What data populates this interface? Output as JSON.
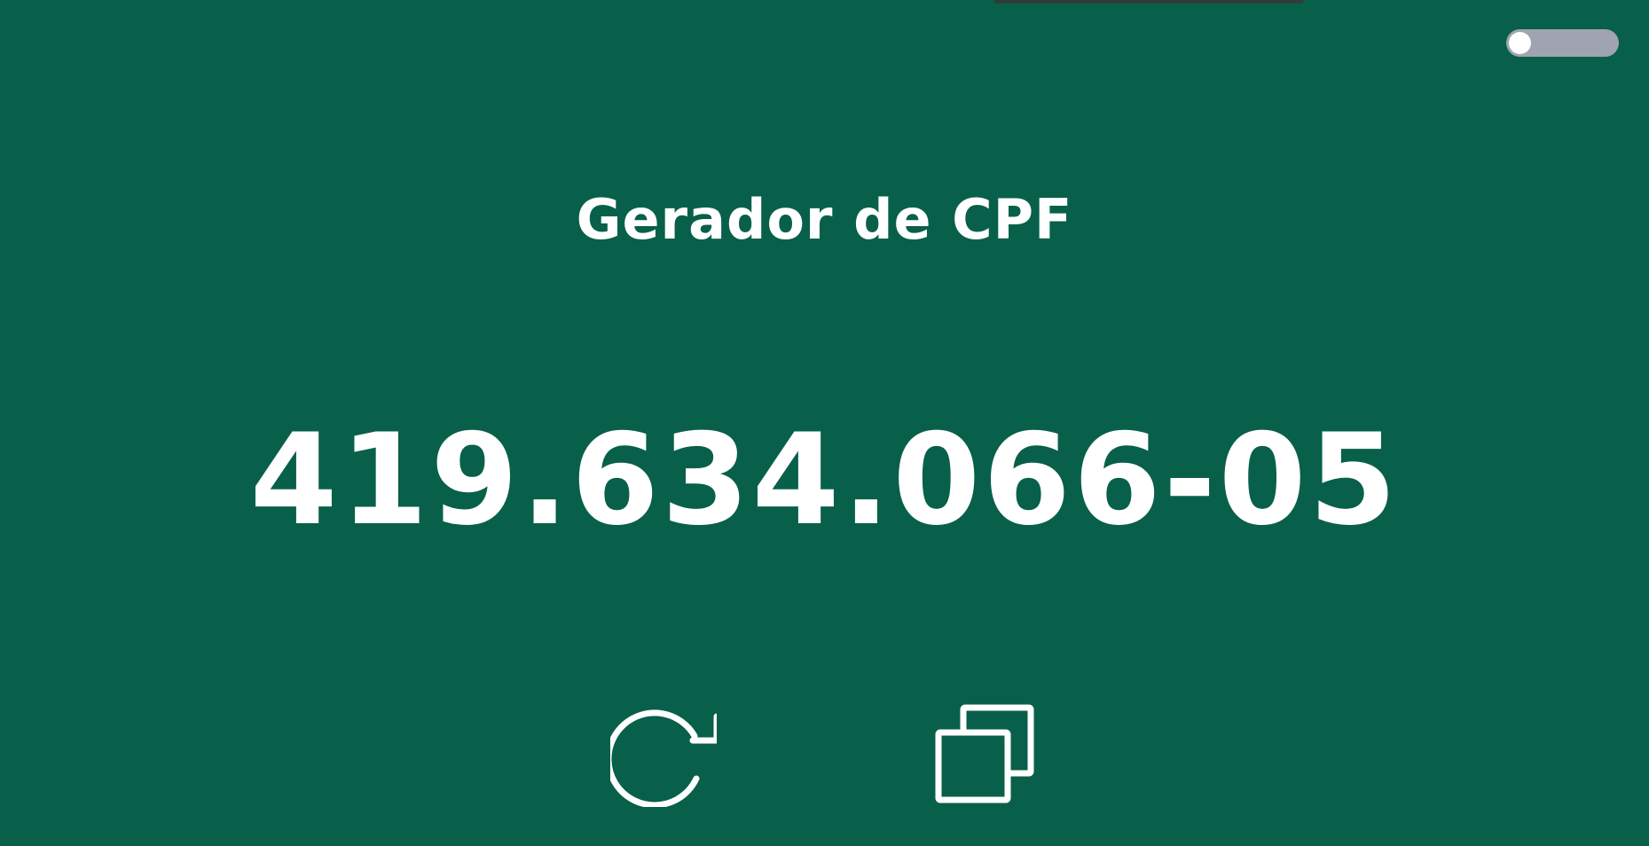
{
  "app": {
    "title": "Gerador de CPF",
    "cpf": "419.634.066-05"
  },
  "controls": {
    "theme_toggle_on": false
  },
  "icons": {
    "refresh": "refresh-icon",
    "copy": "copy-icon"
  },
  "colors": {
    "background": "#08604a",
    "foreground": "#ffffff",
    "toggle_track": "#a0a4b0"
  }
}
